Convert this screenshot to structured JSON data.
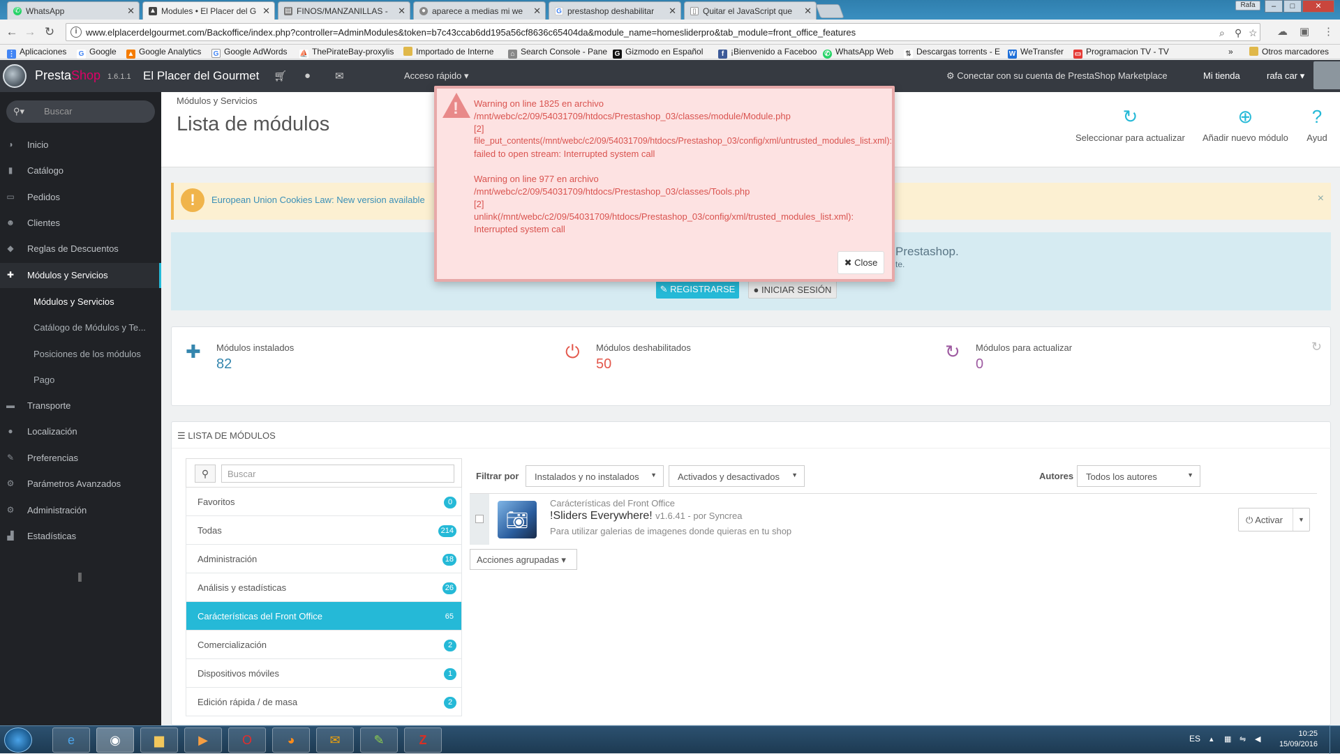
{
  "browser": {
    "tabs": [
      {
        "title": "WhatsApp",
        "icon": "whatsapp-icon",
        "color": "#25d366"
      },
      {
        "title": "Modules • El Placer del G",
        "icon": "prestashop-icon",
        "color": "#555555",
        "active": true
      },
      {
        "title": "FINOS/MANZANILLAS - ",
        "icon": "page-icon",
        "color": "#666666"
      },
      {
        "title": "aparece a medias mi we",
        "icon": "prestashop-icon",
        "color": "#777777"
      },
      {
        "title": "prestashop deshabilitar",
        "icon": "google-icon",
        "color": "#4285f4"
      },
      {
        "title": "Quitar el JavaScript que",
        "icon": "page-icon",
        "color": "#666666"
      }
    ],
    "window_user": "Rafa",
    "url": "www.elplacerdelgourmet.com/Backoffice/index.php?controller=AdminModules&token=b7c43ccab6dd195a56cf8636c65404da&module_name=homesliderpro&tab_module=front_office_features",
    "bookmarks": [
      {
        "label": "Aplicaciones",
        "icon": "apps-grid-icon",
        "color": "#4285f4"
      },
      {
        "label": "Google",
        "icon": "google-icon",
        "color": "#4285f4"
      },
      {
        "label": "Google Analytics",
        "icon": "analytics-icon",
        "color": "#f57c00"
      },
      {
        "label": "Google AdWords",
        "icon": "adwords-icon",
        "color": "#4285f4"
      },
      {
        "label": "ThePirateBay-proxylis",
        "icon": "pirate-ship-icon",
        "color": "#333333"
      },
      {
        "label": "Importado de Interne",
        "icon": "folder-icon",
        "color": "#e0b84a"
      },
      {
        "label": "Search Console - Pane",
        "icon": "search-console-icon",
        "color": "#777777"
      },
      {
        "label": "Gizmodo en Español",
        "icon": "gizmodo-icon",
        "color": "#111111"
      },
      {
        "label": "¡Bienvenido a Faceboo",
        "icon": "facebook-icon",
        "color": "#3b5998"
      },
      {
        "label": "WhatsApp Web",
        "icon": "whatsapp-icon",
        "color": "#25d366"
      },
      {
        "label": "Descargas torrents - E",
        "icon": "torrent-icon",
        "color": "#555555"
      },
      {
        "label": "WeTransfer",
        "icon": "wetransfer-icon",
        "color": "#1e6fd9"
      },
      {
        "label": "Programacion TV - TV",
        "icon": "tv-icon",
        "color": "#e53935"
      }
    ],
    "bookmarks_more": "»",
    "other_bookmarks": "Otros marcadores"
  },
  "header": {
    "brand_presta": "Presta",
    "brand_shop": "Shop",
    "version": "1.6.1.1",
    "shop_name": "El Placer del Gourmet",
    "quick_access": "Acceso rápido",
    "marketplace": "Conectar con su cuenta de PrestaShop Marketplace",
    "my_shop": "Mi tienda",
    "user": "rafa car"
  },
  "sidebar": {
    "search_placeholder": "Buscar",
    "items": [
      {
        "label": "Inicio",
        "icon": "dashboard-icon"
      },
      {
        "label": "Catálogo",
        "icon": "book-icon"
      },
      {
        "label": "Pedidos",
        "icon": "credit-card-icon"
      },
      {
        "label": "Clientes",
        "icon": "users-icon"
      },
      {
        "label": "Reglas de Descuentos",
        "icon": "tags-icon"
      },
      {
        "label": "Módulos y Servicios",
        "icon": "puzzle-icon",
        "active": true
      },
      {
        "label": "Transporte",
        "icon": "truck-icon"
      },
      {
        "label": "Localización",
        "icon": "globe-icon"
      },
      {
        "label": "Preferencias",
        "icon": "wrench-icon"
      },
      {
        "label": "Parámetros Avanzados",
        "icon": "cogs-icon"
      },
      {
        "label": "Administración",
        "icon": "cog-icon"
      },
      {
        "label": "Estadísticas",
        "icon": "bar-chart-icon"
      }
    ],
    "subitems": [
      "Módulos y Servicios",
      "Catálogo de Módulos y Te...",
      "Posiciones de los módulos",
      "Pago"
    ]
  },
  "toolbar": {
    "breadcrumb": "Módulos y Servicios",
    "title": "Lista de módulos",
    "buttons": [
      {
        "label": "Seleccionar para actualizar",
        "icon": "refresh-icon"
      },
      {
        "label": "Añadir nuevo módulo",
        "icon": "plus-circle-icon"
      },
      {
        "label": "Ayud",
        "icon": "help-icon"
      }
    ]
  },
  "alert": {
    "text": "European Union Cookies Law: New version available",
    "close": "×"
  },
  "connect": {
    "text_end": "Prestashop.",
    "text_end2": "te.",
    "register": "REGISTRARSE",
    "login": "INICIAR SESIÓN"
  },
  "kpis": [
    {
      "label": "Módulos instalados",
      "value": "82",
      "icon": "puzzle-icon",
      "color": "#3586ae"
    },
    {
      "label": "Módulos deshabilitados",
      "value": "50",
      "icon": "power-icon",
      "color": "#e3574b"
    },
    {
      "label": "Módulos para actualizar",
      "value": "0",
      "icon": "refresh-icon",
      "color": "#9e5ba1"
    }
  ],
  "module_list": {
    "heading": "LISTA DE MÓDULOS",
    "search_placeholder": "Buscar",
    "categories": [
      {
        "label": "Favoritos",
        "count": "0"
      },
      {
        "label": "Todas",
        "count": "214"
      },
      {
        "label": "Administración",
        "count": "18"
      },
      {
        "label": "Análisis y estadísticas",
        "count": "26"
      },
      {
        "label": "Carácterísticas del Front Office",
        "count": "65",
        "selected": true
      },
      {
        "label": "Comercialización",
        "count": "2"
      },
      {
        "label": "Dispositivos móviles",
        "count": "1"
      },
      {
        "label": "Edición rápida / de masa",
        "count": "2"
      }
    ],
    "filter_label": "Filtrar por",
    "filter_install": "Instalados y no instalados",
    "filter_enabled": "Activados y desactivados",
    "authors_label": "Autores",
    "authors_value": "Todos los autores",
    "module": {
      "category": "Carácterísticas del Front Office",
      "name": "!Sliders Everywhere!",
      "meta": "v1.6.41 - por Syncrea",
      "description": "Para utilizar galerias de imagenes donde quieras en tu shop",
      "action": "Activar"
    },
    "bulk_actions": "Acciones agrupadas"
  },
  "modal": {
    "lines": [
      "Warning on line 1825 en archivo",
      "/mnt/webc/c2/09/54031709/htdocs/Prestashop_03/classes/module/Module.php",
      "[2]",
      "file_put_contents(/mnt/webc/c2/09/54031709/htdocs/Prestashop_03/config/xml/untrusted_modules_list.xml):",
      "failed to open stream: Interrupted system call",
      "Warning on line 977 en archivo",
      "/mnt/webc/c2/09/54031709/htdocs/Prestashop_03/classes/Tools.php",
      "[2]",
      "unlink(/mnt/webc/c2/09/54031709/htdocs/Prestashop_03/config/xml/trusted_modules_list.xml):",
      "Interrupted system call"
    ],
    "close": "Close"
  },
  "taskbar": {
    "apps": [
      "ie-icon",
      "chrome-icon",
      "explorer-icon",
      "media-player-icon",
      "opera-icon",
      "firefox-icon",
      "outlook-icon",
      "notepad-icon",
      "filezilla-icon"
    ],
    "lang": "ES",
    "time": "10:25",
    "date": "15/09/2016"
  }
}
